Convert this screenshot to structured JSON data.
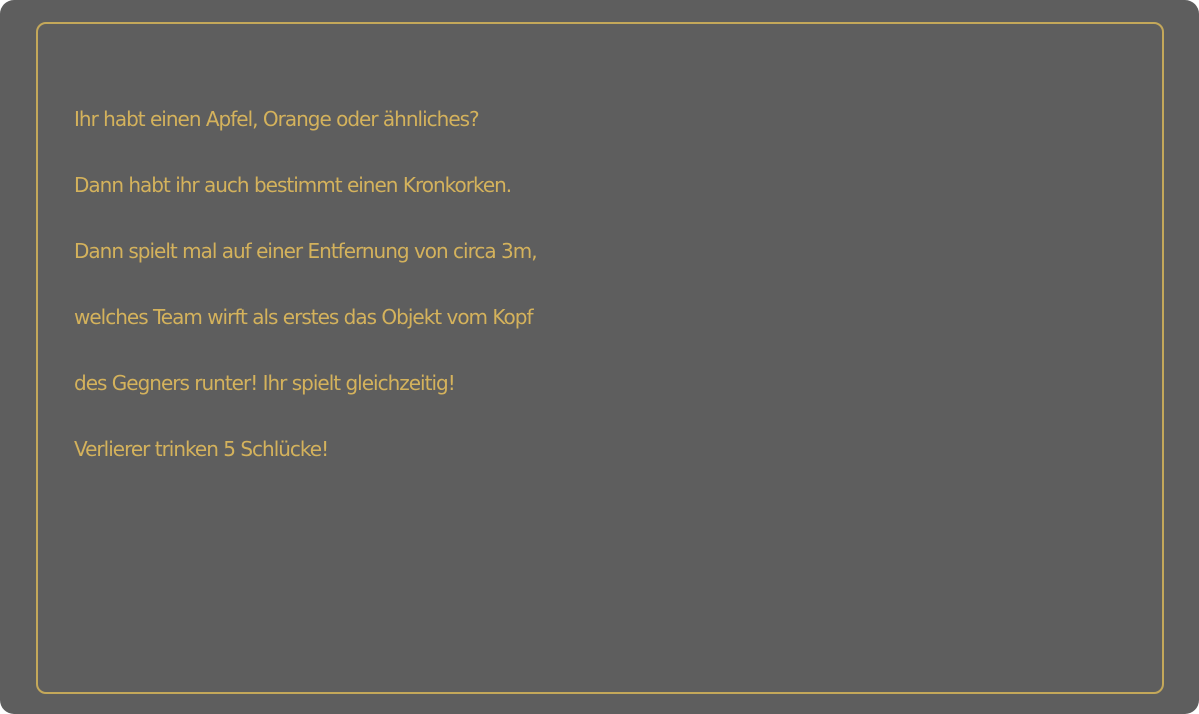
{
  "card": {
    "background": "#5e5e5e",
    "accent": "#d4b25c",
    "lines": [
      "Ihr habt einen Apfel, Orange oder ähnliches?",
      "Dann habt ihr auch bestimmt einen Kronkorken.",
      "Dann spielt mal auf einer Entfernung von circa 3m,",
      "welches Team wirft als erstes das Objekt vom Kopf",
      "des Gegners runter! Ihr spielt gleichzeitig!",
      "Verlierer trinken 5 Schlücke!"
    ]
  }
}
